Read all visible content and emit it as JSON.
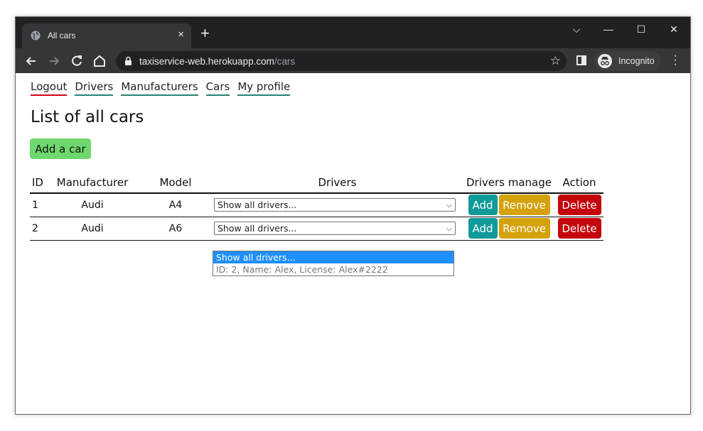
{
  "browser": {
    "tab_title": "All cars",
    "tab_close": "×",
    "new_tab": "+",
    "url_host": "taxiservice-web.herokuapp.com",
    "url_path": "/cars",
    "profile_label": "Incognito",
    "window_controls": {
      "tab_search": "⌵",
      "minimize": "—",
      "maximize": "☐",
      "close": "✕"
    },
    "icons": [
      "globe-icon",
      "back-icon",
      "forward-icon",
      "reload-icon",
      "home-icon",
      "lock-icon",
      "star-icon",
      "side-panel-icon",
      "incognito-icon",
      "menu-icon"
    ]
  },
  "nav": {
    "logout": "Logout",
    "drivers": "Drivers",
    "manufacturers": "Manufacturers",
    "cars": "Cars",
    "my_profile": "My profile"
  },
  "page": {
    "title": "List of all cars",
    "add_car": "Add a car"
  },
  "table": {
    "headers": {
      "id": "ID",
      "manufacturer": "Manufacturer",
      "model": "Model",
      "drivers": "Drivers",
      "drivers_manage": "Drivers manage",
      "action": "Action"
    },
    "rows": [
      {
        "id": "1",
        "manufacturer": "Audi",
        "model": "A4",
        "drivers_select": "Show all drivers...",
        "add": "Add",
        "remove": "Remove",
        "delete": "Delete"
      },
      {
        "id": "2",
        "manufacturer": "Audi",
        "model": "A6",
        "drivers_select": "Show all drivers...",
        "add": "Add",
        "remove": "Remove",
        "delete": "Delete"
      }
    ]
  },
  "dropdown": {
    "options": [
      "Show all drivers...",
      "ID: 2, Name: Alex, License: Alex#2222"
    ]
  },
  "colors": {
    "add_button": "#6ed86e",
    "add_driver": "#0f9a9a",
    "remove_driver": "#d4a20a",
    "delete": "#c4050b",
    "nav_underline": "#2a7f74",
    "logout_underline": "#d0021b",
    "dropdown_highlight": "#1e90ff"
  }
}
